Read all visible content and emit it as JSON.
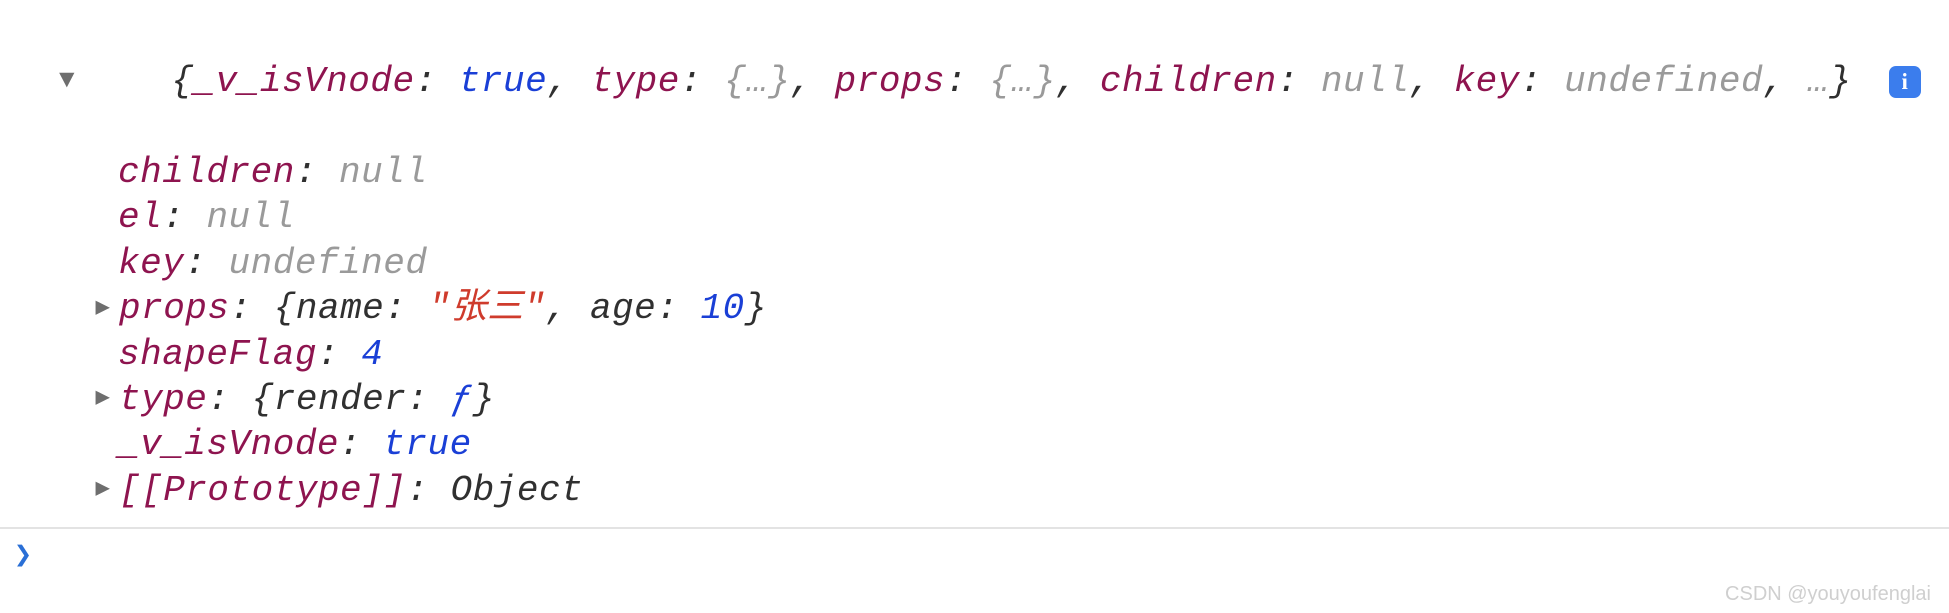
{
  "summary": {
    "open_brace": "{",
    "p1_key": "_v_isVnode",
    "p1_val": "true",
    "p2_key": "type",
    "p2_val": "{…}",
    "p3_key": "props",
    "p3_val": "{…}",
    "p4_key": "children",
    "p4_val": "null",
    "p5_key": "key",
    "p5_val": "undefined",
    "ellipsis": "…",
    "close_brace": "}"
  },
  "props": {
    "children": {
      "k": "children",
      "v": "null"
    },
    "el": {
      "k": "el",
      "v": "null"
    },
    "key": {
      "k": "key",
      "v": "undefined"
    },
    "propsObj": {
      "k": "props",
      "name_k": "name",
      "name_v": "\"张三\"",
      "age_k": "age",
      "age_v": "10"
    },
    "shapeFlag": {
      "k": "shapeFlag",
      "v": "4"
    },
    "typeObj": {
      "k": "type",
      "render_k": "render",
      "render_v": "ƒ"
    },
    "vIsVnode": {
      "k": "_v_isVnode",
      "v": "true"
    },
    "proto": {
      "k": "[[Prototype]]",
      "v": "Object"
    }
  },
  "info_glyph": "i",
  "watermark": "CSDN @youyoufenglai"
}
